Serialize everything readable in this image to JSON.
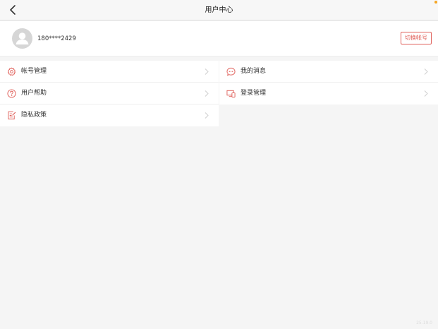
{
  "header": {
    "title": "用户中心"
  },
  "user": {
    "phone": "180****2429",
    "switch_label": "切换帐号"
  },
  "menu_left": [
    {
      "label": "帐号管理",
      "icon": "gear-icon"
    },
    {
      "label": "用户帮助",
      "icon": "question-circle-icon"
    },
    {
      "label": "隐私政策",
      "icon": "document-edit-icon"
    }
  ],
  "menu_right": [
    {
      "label": "我的消息",
      "icon": "message-bubble-icon"
    },
    {
      "label": "登录管理",
      "icon": "devices-icon"
    }
  ],
  "footer": {
    "version": "25.19.0"
  },
  "colors": {
    "accent": "#e0605a",
    "background": "#f5f5f5",
    "notification_dot": "#f5a623"
  }
}
